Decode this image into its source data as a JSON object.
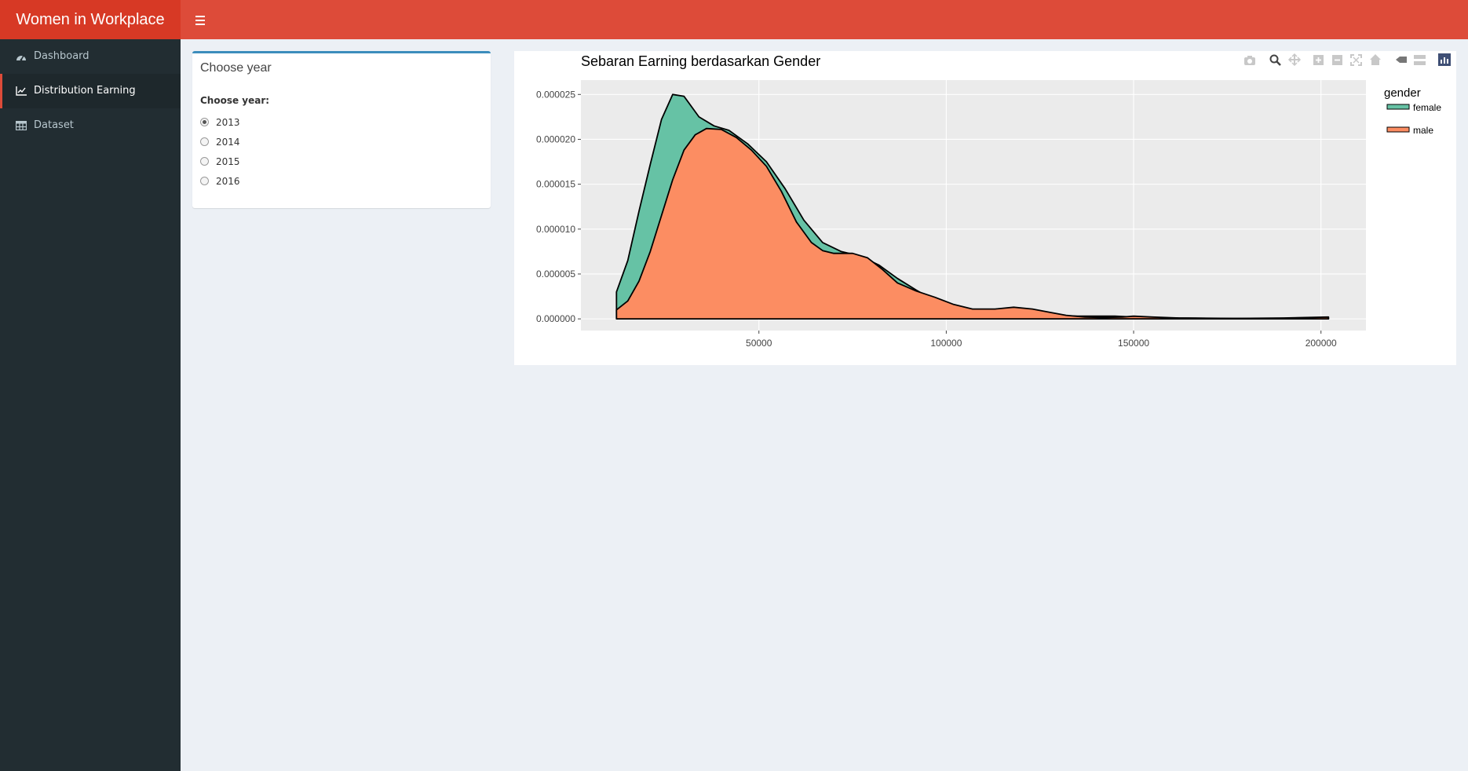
{
  "app": {
    "title": "Women in Workplace"
  },
  "sidebar": {
    "items": [
      {
        "label": "Dashboard",
        "icon": "dashboard-icon",
        "active": false
      },
      {
        "label": "Distribution Earning",
        "icon": "line-chart-icon",
        "active": true
      },
      {
        "label": "Dataset",
        "icon": "table-icon",
        "active": false
      }
    ]
  },
  "year_box": {
    "title": "Choose year",
    "label": "Choose year:",
    "options": [
      "2013",
      "2014",
      "2015",
      "2016"
    ],
    "selected": "2013"
  },
  "colors": {
    "header": "#dd4b39",
    "logo": "#d73925",
    "sidebar": "#222d32",
    "female": "#66c2a5",
    "male": "#fc8d62",
    "plot_bg": "#ebebeb"
  },
  "chart_data": {
    "type": "area",
    "title": "Sebaran Earning berdasarkan Gender",
    "legend_title": "gender",
    "legend_position": "right",
    "grid": true,
    "xlim": [
      2500,
      212000
    ],
    "ylim": [
      -1.3e-06,
      2.66e-05
    ],
    "x_ticks": [
      50000,
      100000,
      150000,
      200000
    ],
    "x_tick_labels": [
      "50000",
      "100000",
      "150000",
      "200000"
    ],
    "y_ticks": [
      0,
      5e-06,
      1e-05,
      1.5e-05,
      2e-05,
      2.5e-05
    ],
    "y_tick_labels": [
      "0.000000",
      "0.000005",
      "0.000010",
      "0.000015",
      "0.000020",
      "0.000025"
    ],
    "series": [
      {
        "name": "female",
        "color": "#66c2a5",
        "points": [
          [
            12000,
            3e-06
          ],
          [
            15000,
            6.5e-06
          ],
          [
            18000,
            1.2e-05
          ],
          [
            21000,
            1.72e-05
          ],
          [
            24000,
            2.22e-05
          ],
          [
            27000,
            2.5e-05
          ],
          [
            30000,
            2.48e-05
          ],
          [
            34000,
            2.25e-05
          ],
          [
            38000,
            2.15e-05
          ],
          [
            42000,
            2.1e-05
          ],
          [
            47000,
            1.95e-05
          ],
          [
            52000,
            1.75e-05
          ],
          [
            57000,
            1.45e-05
          ],
          [
            62000,
            1.1e-05
          ],
          [
            67000,
            8.5e-06
          ],
          [
            72000,
            7.5e-06
          ],
          [
            77000,
            7e-06
          ],
          [
            82000,
            6e-06
          ],
          [
            87000,
            4.5e-06
          ],
          [
            92000,
            3.2e-06
          ],
          [
            97000,
            2e-06
          ],
          [
            102000,
            1.2e-06
          ],
          [
            107000,
            8e-07
          ],
          [
            115000,
            6e-07
          ],
          [
            125000,
            4e-07
          ],
          [
            135000,
            3e-07
          ],
          [
            145000,
            3e-07
          ],
          [
            150000,
            2e-07
          ],
          [
            160000,
            1e-07
          ],
          [
            180000,
            5e-08
          ],
          [
            202000,
            1e-07
          ]
        ]
      },
      {
        "name": "male",
        "color": "#fc8d62",
        "points": [
          [
            12000,
            1e-06
          ],
          [
            15000,
            2e-06
          ],
          [
            18000,
            4.2e-06
          ],
          [
            21000,
            7.5e-06
          ],
          [
            24000,
            1.15e-05
          ],
          [
            27000,
            1.55e-05
          ],
          [
            30000,
            1.88e-05
          ],
          [
            33000,
            2.05e-05
          ],
          [
            36000,
            2.12e-05
          ],
          [
            40000,
            2.11e-05
          ],
          [
            44000,
            2.02e-05
          ],
          [
            48000,
            1.88e-05
          ],
          [
            52000,
            1.7e-05
          ],
          [
            56000,
            1.42e-05
          ],
          [
            60000,
            1.08e-05
          ],
          [
            64000,
            8.5e-06
          ],
          [
            67000,
            7.6e-06
          ],
          [
            70000,
            7.3e-06
          ],
          [
            75000,
            7.3e-06
          ],
          [
            79000,
            6.8e-06
          ],
          [
            83000,
            5.5e-06
          ],
          [
            87000,
            4e-06
          ],
          [
            92000,
            3.1e-06
          ],
          [
            97000,
            2.4e-06
          ],
          [
            102000,
            1.6e-06
          ],
          [
            107000,
            1.1e-06
          ],
          [
            113000,
            1.1e-06
          ],
          [
            118000,
            1.3e-06
          ],
          [
            123000,
            1.1e-06
          ],
          [
            128000,
            7e-07
          ],
          [
            132000,
            4e-07
          ],
          [
            137000,
            2e-07
          ],
          [
            142000,
            1.5e-07
          ],
          [
            147000,
            2e-07
          ],
          [
            150000,
            3e-07
          ],
          [
            155000,
            2e-07
          ],
          [
            162000,
            1e-07
          ],
          [
            175000,
            5e-08
          ],
          [
            190000,
            1e-07
          ],
          [
            202000,
            2e-07
          ]
        ]
      }
    ]
  },
  "modebar": {
    "icons": [
      "camera-icon",
      "zoom-icon",
      "pan-icon",
      "zoom-in-icon",
      "zoom-out-icon",
      "autoscale-icon",
      "reset-axes-icon",
      "hover-closest-icon",
      "hover-compare-icon",
      "plotly-logo-icon"
    ]
  }
}
